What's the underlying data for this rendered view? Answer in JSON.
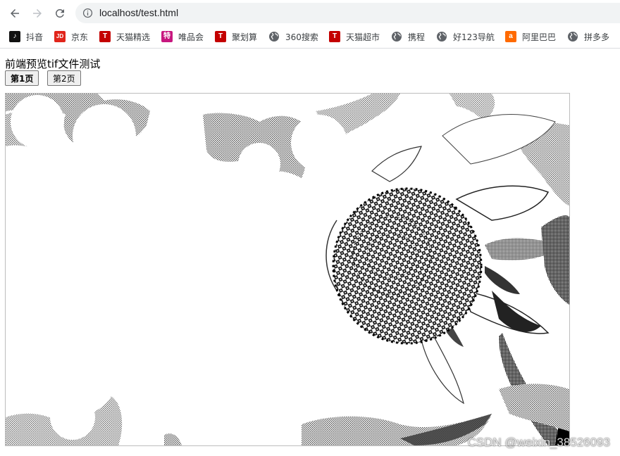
{
  "browser": {
    "url": "localhost/test.html",
    "icons": {
      "back": "arrow-left-icon",
      "forward": "arrow-right-icon",
      "reload": "reload-icon",
      "info": "info-icon"
    }
  },
  "bookmarks": [
    {
      "label": "抖音",
      "icon": "douyin-icon",
      "glyph": "♪",
      "color": "#111111"
    },
    {
      "label": "京东",
      "icon": "jd-icon",
      "glyph": "JD",
      "color": "#e1251b"
    },
    {
      "label": "天猫精选",
      "icon": "tmall-icon",
      "glyph": "T",
      "color": "#c40000"
    },
    {
      "label": "唯品会",
      "icon": "vip-icon",
      "glyph": "特",
      "color": "#c7177f"
    },
    {
      "label": "聚划算",
      "icon": "juhuasuan-icon",
      "glyph": "T",
      "color": "#c40000"
    },
    {
      "label": "360搜索",
      "icon": "globe-icon",
      "glyph": "",
      "color": "#5f6368"
    },
    {
      "label": "天猫超市",
      "icon": "tmall-icon",
      "glyph": "T",
      "color": "#c40000"
    },
    {
      "label": "携程",
      "icon": "globe-icon",
      "glyph": "",
      "color": "#5f6368"
    },
    {
      "label": "好123导航",
      "icon": "globe-icon",
      "glyph": "",
      "color": "#5f6368"
    },
    {
      "label": "阿里巴巴",
      "icon": "alibaba-icon",
      "glyph": "a",
      "color": "#ff6a00"
    },
    {
      "label": "拼多多",
      "icon": "globe-icon",
      "glyph": "",
      "color": "#5f6368"
    }
  ],
  "page": {
    "title": "前端预览tif文件测试",
    "buttons": [
      {
        "label": "第1页",
        "active": true
      },
      {
        "label": "第2页",
        "active": false
      }
    ]
  },
  "watermark": "CSDN @weixin_38526093"
}
